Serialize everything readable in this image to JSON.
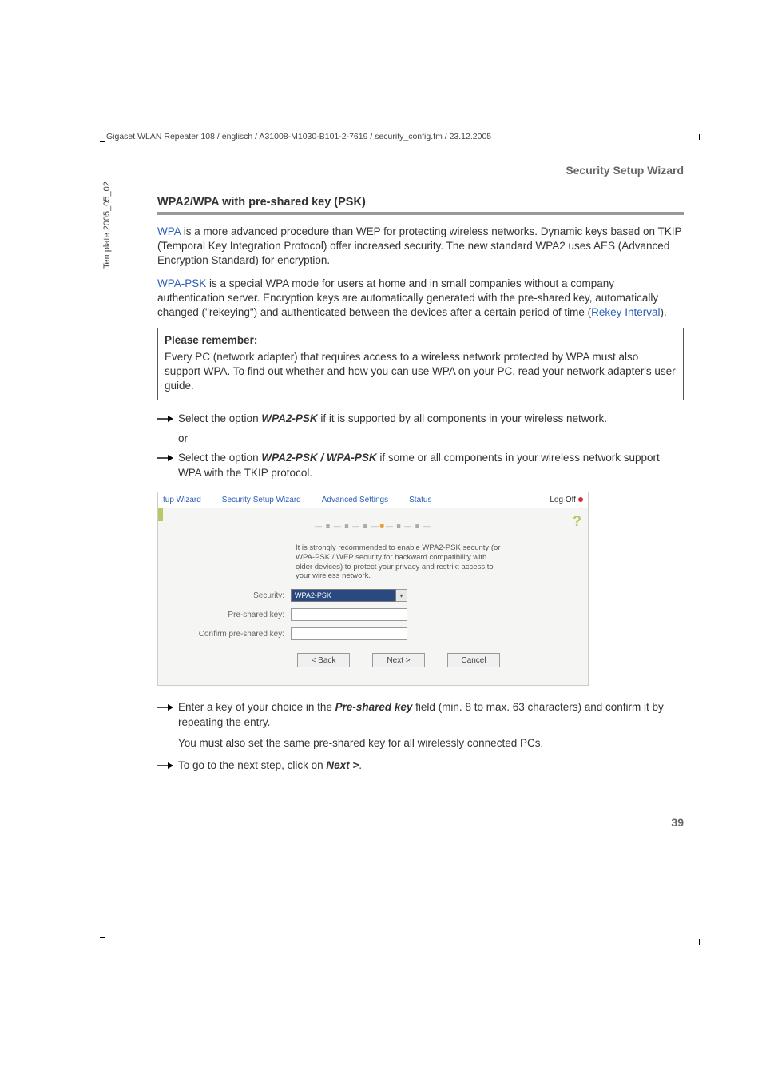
{
  "meta": {
    "line": "Gigaset WLAN Repeater 108 / englisch / A31008-M1030-B101-2-7619 / security_config.fm / 23.12.2005",
    "side_template": "Template 2005_05_02"
  },
  "header": {
    "title": "Security Setup Wizard"
  },
  "section": {
    "title": "WPA2/WPA with pre-shared key (PSK)"
  },
  "para1": {
    "link": "WPA",
    "rest": " is a more advanced procedure than WEP for protecting wireless networks. Dynamic keys based on TKIP (Temporal Key Integration Protocol) offer increased security. The new standard WPA2 uses AES (Advanced Encryption Standard) for encryption."
  },
  "para2": {
    "link": "WPA-PSK",
    "rest1": " is a special WPA mode for users at home and in small companies without a company authentication server. Encryption keys are automatically generated with the pre-shared key, automatically changed (\"rekeying\") and authenticated between the devices after a certain period of time (",
    "link2": "Rekey Interval",
    "rest2": ")."
  },
  "note": {
    "title": "Please remember:",
    "body": "Every PC (network adapter) that requires access to a wireless network protected by WPA must also support WPA. To find out whether and how you can use WPA on your PC, read your network adapter's user guide."
  },
  "step1": {
    "pre": "Select the option ",
    "emph": "WPA2-PSK",
    "post": " if it is supported by all components in your wireless network."
  },
  "or": "or",
  "step2": {
    "pre": "Select the option ",
    "emph": "WPA2-PSK / WPA-PSK",
    "post": " if some or all components in your wireless network support WPA with the TKIP protocol."
  },
  "screenshot": {
    "tabs": {
      "cut": "tup Wizard",
      "active": "Security Setup Wizard",
      "adv": "Advanced Settings",
      "status": "Status",
      "logoff": "Log Off"
    },
    "help": "?",
    "desc": "It is strongly recommended to enable WPA2-PSK security (or WPA-PSK / WEP security for backward compatibility with older devices) to protect your privacy and restrikt access to your wireless network.",
    "labels": {
      "security": "Security:",
      "psk": "Pre-shared key:",
      "confirm": "Confirm pre-shared key:"
    },
    "select_value": "WPA2-PSK",
    "buttons": {
      "back": "< Back",
      "next": "Next >",
      "cancel": "Cancel"
    }
  },
  "step3": {
    "pre": "Enter a key of your choice in the ",
    "emph": "Pre-shared key",
    "post": " field (min. 8 to max. 63 characters) and confirm it by repeating the entry."
  },
  "step3_sub": "You must also set the same pre-shared key for all wirelessly connected PCs.",
  "step4": {
    "pre": "To go to the next step, click on ",
    "emph": "Next >",
    "post": "."
  },
  "page_number": "39"
}
